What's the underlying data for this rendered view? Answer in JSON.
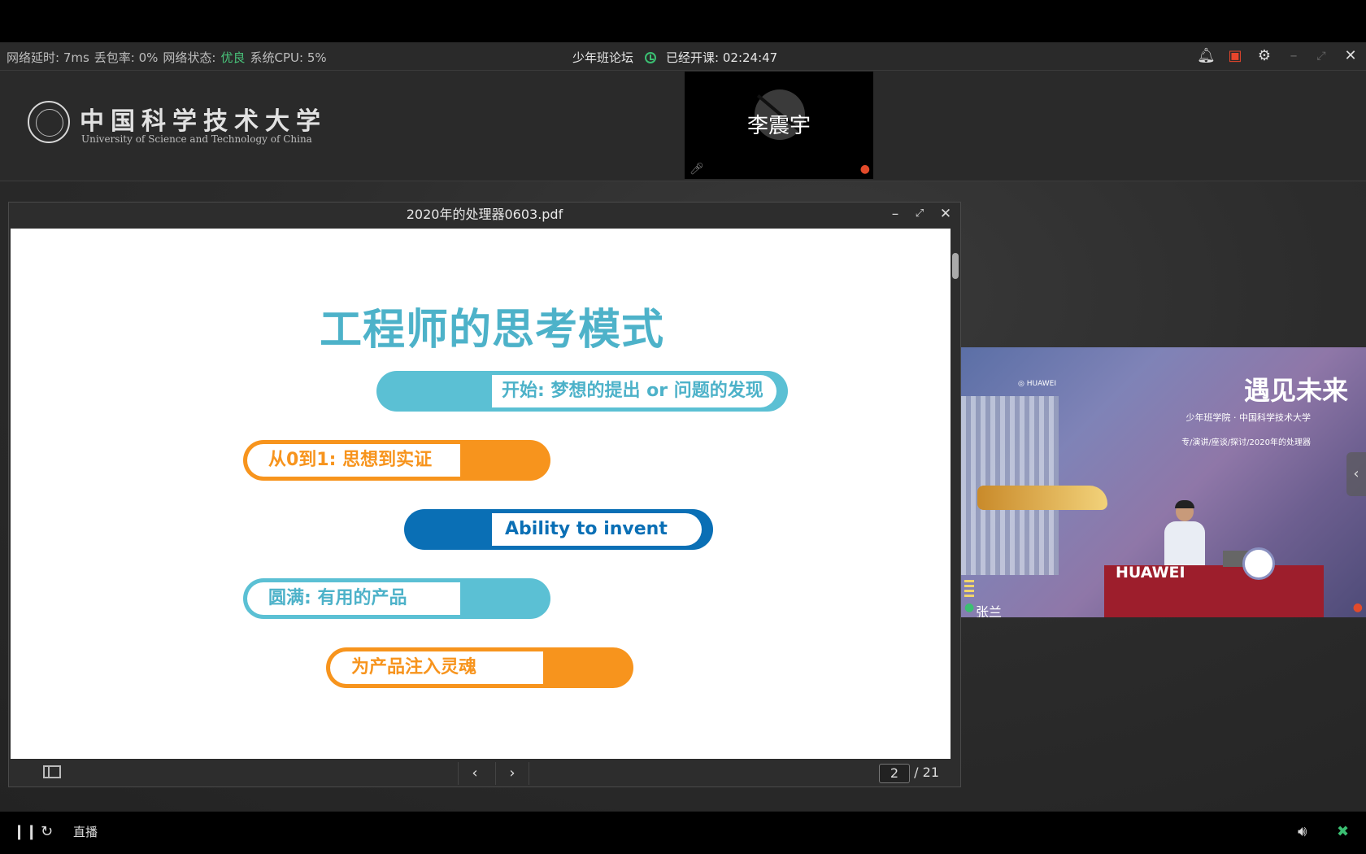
{
  "status_bar": {
    "latency": "网络延时: 7ms",
    "packet_loss": "丢包率: 0%",
    "network_label": "网络状态:",
    "network_value": "优良",
    "cpu": "系统CPU: 5%",
    "course_title": "少年班论坛",
    "elapsed_label": "已经开课:",
    "elapsed_time": "02:24:47",
    "accent_color": "#49c37a"
  },
  "toolbar_icons": [
    "bell-icon",
    "gift-icon",
    "gear-icon",
    "minimize-icon",
    "maximize-icon",
    "close-icon"
  ],
  "logo": {
    "cn": "中国科学技术大学",
    "en": "University of Science and Technology of China"
  },
  "participant": {
    "name": "李震宇"
  },
  "pdf": {
    "filename": "2020年的处理器0603.pdf",
    "slide": {
      "title": "工程师的思考模式",
      "items": [
        "开始: 梦想的提出 or 问题的发现",
        "从0到1: 思想到实证",
        "Ability to invent",
        "圆满: 有用的产品",
        "为产品注入灵魂"
      ]
    },
    "current_page": "2",
    "total_pages": "/ 21"
  },
  "video": {
    "headline": "遇见未来",
    "subline": "少年班学院 · 中国科学技术大学",
    "tagline": "专/演讲/座谈/探讨/2020年的处理器",
    "sponsor": "HUAWEI",
    "speaker_name": "张兰"
  },
  "bottom_bar": {
    "live_label": "直播"
  }
}
